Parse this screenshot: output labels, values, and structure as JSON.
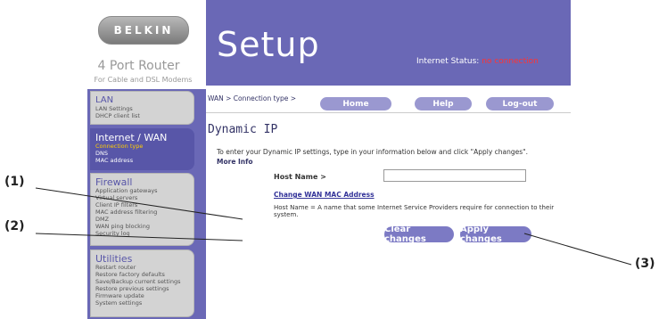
{
  "brand": {
    "logo_text": "BELKIN",
    "product": "4 Port Router",
    "subtitle": "For Cable and DSL Modems"
  },
  "sidebar": {
    "menus": [
      {
        "title": "LAN",
        "items": [
          "LAN Settings",
          "DHCP client list"
        ]
      },
      {
        "title": "Internet / WAN",
        "items": [
          "Connection type",
          "DNS",
          "MAC address"
        ],
        "active": true,
        "current": "Connection type"
      },
      {
        "title": "Firewall",
        "items": [
          "Application gateways",
          "Virtual servers",
          "Client IP filters",
          "MAC address filtering",
          "DMZ",
          "WAN ping blocking",
          "Security log"
        ]
      },
      {
        "title": "Utilities",
        "items": [
          "Restart router",
          "Restore factory defaults",
          "Save/Backup current settings",
          "Restore previous settings",
          "Firmware update",
          "System settings"
        ]
      }
    ]
  },
  "header": {
    "title": "Setup",
    "status_label": "Internet Status:",
    "status_value": "no connection"
  },
  "nav": {
    "breadcrumb": "WAN > Connection type >",
    "home": "Home",
    "help": "Help",
    "logout": "Log-out"
  },
  "page": {
    "title": "Dynamic IP",
    "intro": "To enter your Dynamic IP settings, type in your information below and click \"Apply changes\".",
    "more_info": "More Info",
    "host_label": "Host Name >",
    "host_value": "",
    "mac_link": "Change WAN MAC Address",
    "host_note": "Host Name = A name that some Internet Service Providers require for connection to their system.",
    "clear_button": "Clear changes",
    "apply_button": "Apply changes"
  },
  "callouts": [
    "(1)",
    "(2)",
    "(3)"
  ],
  "colors": {
    "purple": "#6a68b6",
    "button": "#9a98d0",
    "status_red": "#ff3333"
  }
}
